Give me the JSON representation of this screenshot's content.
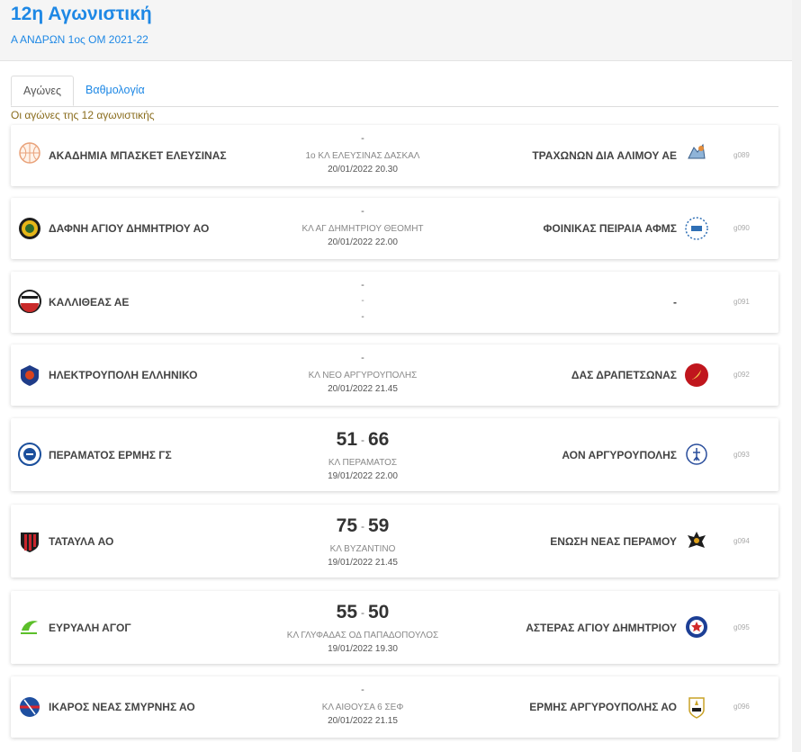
{
  "page": {
    "title": "12η Αγωνιστική",
    "subtitle": "Α ΑΝΔΡΩΝ 1ος ΟΜ 2021-22"
  },
  "tabs": [
    {
      "label": "Αγώνες",
      "active": true
    },
    {
      "label": "Βαθμολογία",
      "active": false
    }
  ],
  "round_caption": "Οι αγώνες της 12 αγωνιστικής",
  "colors": {
    "accent": "#1e88e5",
    "caption": "#8a6d1e"
  },
  "games": [
    {
      "home": "ΑΚΑΔΗΜΙΑ ΜΠΑΣΚΕΤ ΕΛΕΥΣΙΝΑΣ",
      "away": "ΤΡΑΧΩΝΩΝ ΔΙΑ ΑΛΙΜΟΥ ΑΕ",
      "top": "-",
      "venue": "1ο ΚΛ ΕΛΕΥΣΙΝΑΣ ΔΑΣΚΑΛ",
      "datetime": "20/01/2022 20.30",
      "code": "g089",
      "home_logo": "basketball-icon",
      "away_logo": "mascot-icon"
    },
    {
      "home": "ΔΑΦΝΗ ΑΓΙΟΥ ΔΗΜΗΤΡΙΟΥ ΑΟ",
      "away": "ΦΟΙΝΙΚΑΣ ΠΕΙΡΑΙΑ ΑΦΜΣ",
      "top": "-",
      "venue": "ΚΛ ΑΓ ΔΗΜΗΤΡΙΟΥ ΘΕΟΜΗΤ",
      "datetime": "20/01/2022 22.00",
      "code": "g090",
      "home_logo": "laurel-crest-icon",
      "away_logo": "phoenix-crest-icon"
    },
    {
      "home": "ΚΑΛΛΙΘΕΑΣ ΑΕ",
      "away": "-",
      "top": "-",
      "venue": "-",
      "datetime": "-",
      "code": "g091",
      "home_logo": "kallithea-crest-icon",
      "away_logo": ""
    },
    {
      "home": "ΗΛΕΚΤΡΟΥΠΟΛΗ ΕΛΛΗΝΙΚΟ",
      "away": "ΔΑΣ ΔΡΑΠΕΤΣΩΝΑΣ",
      "top": "-",
      "venue": "ΚΛ ΝΕΟ ΑΡΓΥΡΟΥΠΟΛΗΣ",
      "datetime": "20/01/2022 21.45",
      "code": "g092",
      "home_logo": "electric-crest-icon",
      "away_logo": "red-bird-crest-icon"
    },
    {
      "home": "ΠΕΡΑΜΑΤΟΣ ΕΡΜΗΣ ΓΣ",
      "away": "ΑΟΝ ΑΡΓΥΡΟΥΠΟΛΗΣ",
      "home_score": "51",
      "away_score": "66",
      "score_sep": "-",
      "venue": "ΚΛ ΠΕΡΑΜΑΤΟΣ",
      "datetime": "19/01/2022 22.00",
      "code": "g093",
      "home_logo": "blue-crest-icon",
      "away_logo": "blue-figure-crest-icon"
    },
    {
      "home": "ΤΑΤΑΥΛΑ ΑΟ",
      "away": "ΕΝΩΣΗ ΝΕΑΣ ΠΕΡΑΜΟΥ",
      "home_score": "75",
      "away_score": "59",
      "score_sep": "-",
      "venue": "ΚΛ ΒΥΖΑΝΤΙΝΟ",
      "datetime": "19/01/2022 21.45",
      "code": "g094",
      "home_logo": "striped-shield-icon",
      "away_logo": "eagle-crest-icon"
    },
    {
      "home": "ΕΥΡΥΑΛΗ ΑΓΟΓ",
      "away": "ΑΣΤΕΡΑΣ ΑΓΙΟΥ ΔΗΜΗΤΡΙΟΥ",
      "home_score": "55",
      "away_score": "50",
      "score_sep": "-",
      "venue": "ΚΛ ΓΛΥΦΑΔΑΣ ΟΔ ΠΑΠΑΔΟΠΟΥΛΟΣ",
      "datetime": "19/01/2022 19.30",
      "code": "g095",
      "home_logo": "green-logo-icon",
      "away_logo": "star-crest-icon"
    },
    {
      "home": "ΙΚΑΡΟΣ ΝΕΑΣ ΣΜΥΡΝΗΣ ΑΟ",
      "away": "ΕΡΜΗΣ ΑΡΓΥΡΟΥΠΟΛΗΣ ΑΟ",
      "top": "-",
      "venue": "ΚΛ ΑΙΘΟΥΣΑ 6 ΣΕΦ",
      "datetime": "20/01/2022 21.15",
      "code": "g096",
      "home_logo": "ikaros-ball-icon",
      "away_logo": "hermes-crest-icon"
    }
  ]
}
